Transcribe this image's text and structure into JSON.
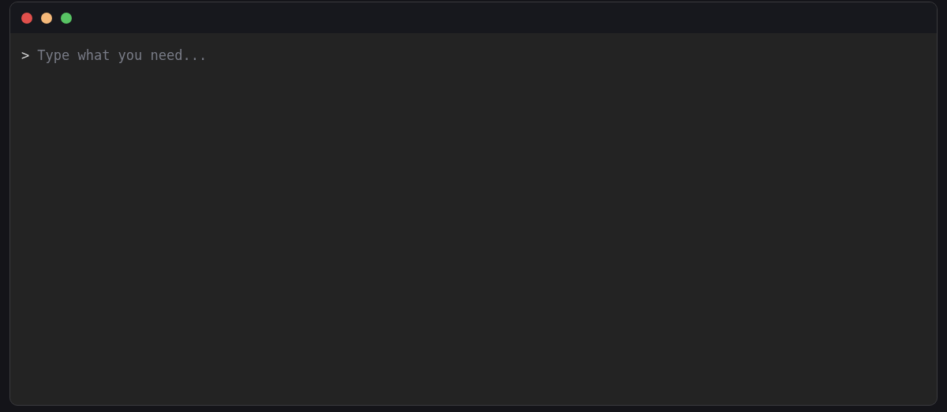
{
  "window": {
    "controls": [
      {
        "color": "#e0504c"
      },
      {
        "color": "#f5b97a"
      },
      {
        "color": "#58c464"
      }
    ]
  },
  "prompt": {
    "symbol": ">",
    "placeholder": "Type what you need..."
  }
}
